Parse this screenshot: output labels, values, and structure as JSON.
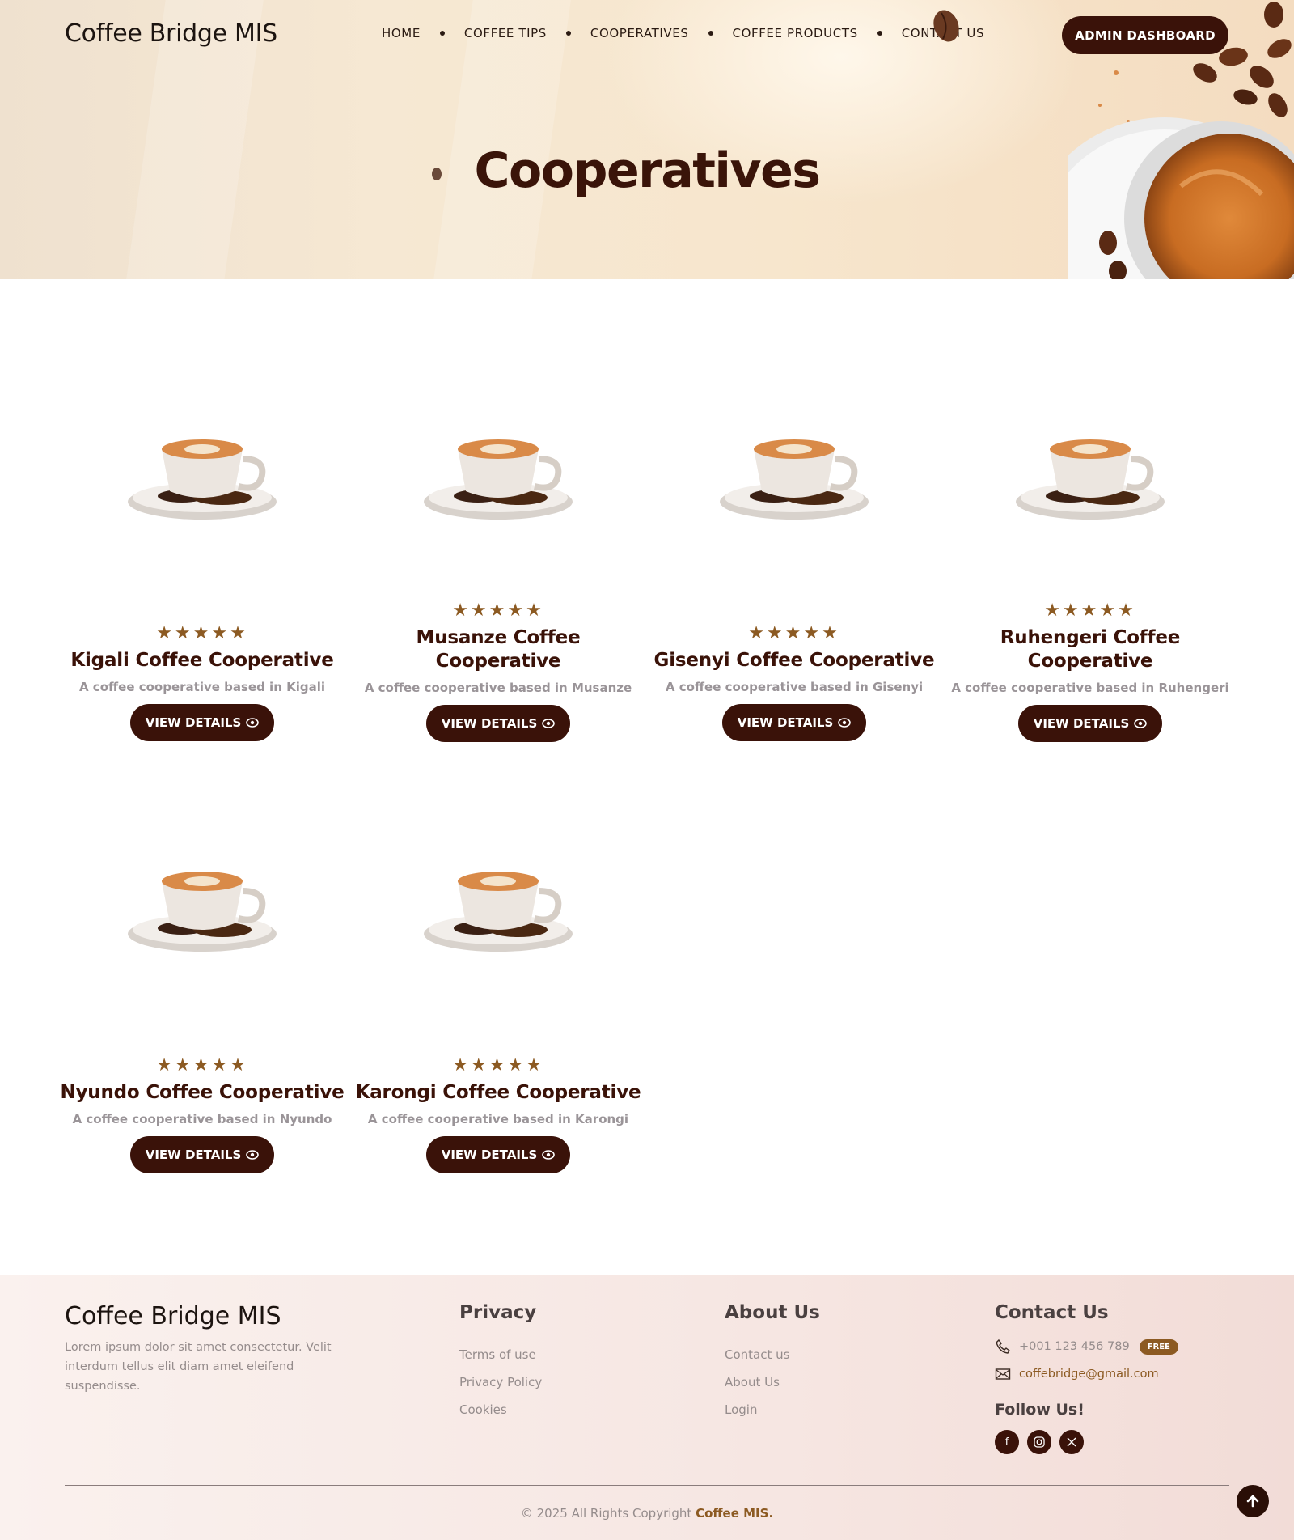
{
  "header": {
    "brand": "Coffee Bridge MIS",
    "nav": [
      "HOME",
      "COFFEE TIPS",
      "COOPERATIVES",
      "COFFEE PRODUCTS",
      "CONTACT US"
    ],
    "admin_button": "ADMIN DASHBOARD"
  },
  "hero": {
    "title": "Cooperatives"
  },
  "cooperatives": [
    {
      "name": "Kigali Coffee Cooperative",
      "description": "A coffee cooperative based in Kigali",
      "stars": "★★★★★",
      "button": "VIEW DETAILS",
      "rating": 5
    },
    {
      "name": "Musanze Coffee Cooperative",
      "description": "A coffee cooperative based in Musanze",
      "stars": "★★★★★",
      "button": "VIEW DETAILS",
      "rating": 5
    },
    {
      "name": "Gisenyi Coffee Cooperative",
      "description": "A coffee cooperative based in Gisenyi",
      "stars": "★★★★★",
      "button": "VIEW DETAILS",
      "rating": 5
    },
    {
      "name": "Ruhengeri Coffee Cooperative",
      "description": "A coffee cooperative based in Ruhengeri",
      "stars": "★★★★★",
      "button": "VIEW DETAILS",
      "rating": 5
    },
    {
      "name": "Nyundo Coffee Cooperative",
      "description": "A coffee cooperative based in Nyundo",
      "stars": "★★★★★",
      "button": "VIEW DETAILS",
      "rating": 5
    },
    {
      "name": "Karongi Coffee Cooperative",
      "description": "A coffee cooperative based in Karongi",
      "stars": "★★★★★",
      "button": "VIEW DETAILS",
      "rating": 5
    }
  ],
  "footer": {
    "brand": "Coffee Bridge MIS",
    "description": "Lorem ipsum dolor sit amet consectetur. Velit interdum tellus elit diam amet eleifend suspendisse.",
    "privacy": {
      "heading": "Privacy",
      "links": [
        "Terms of use",
        "Privacy Policy",
        "Cookies"
      ]
    },
    "about": {
      "heading": "About Us",
      "links": [
        "Contact us",
        "About Us",
        "Login"
      ]
    },
    "contact": {
      "heading": "Contact Us",
      "phone": "+001 123 456 789",
      "badge": "FREE",
      "email": "coffebridge@gmail.com",
      "follow": "Follow Us!"
    },
    "copyright_prefix": "© 2025 All Rights Copyright",
    "copyright_brand": "Coffee MIS."
  },
  "icons": {
    "eye": "eye-icon",
    "phone": "phone-icon",
    "mail": "mail-icon",
    "facebook": "facebook-icon",
    "instagram": "instagram-icon",
    "x": "x-icon",
    "to_top": "arrow-up-icon"
  },
  "colors": {
    "brand_dark": "#3a1209",
    "accent": "#8c5a22",
    "muted_text": "#958c8c"
  }
}
